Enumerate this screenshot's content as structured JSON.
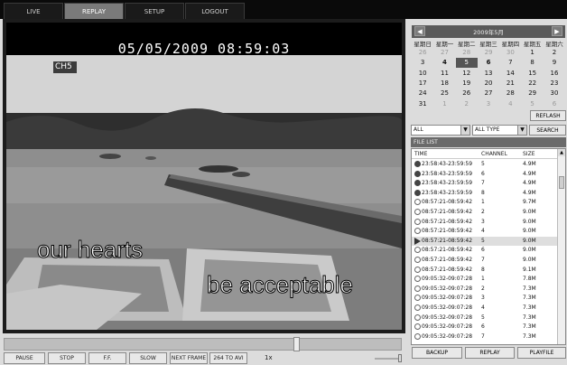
{
  "tabs": [
    "LIVE",
    "REPLAY",
    "SETUP",
    "LOGOUT"
  ],
  "video": {
    "timestamp": "05/05/2009 08:59:03",
    "channel_label": "CH5",
    "caption_line1": "our hearts",
    "caption_line2": "be acceptable"
  },
  "controls": {
    "buttons": [
      "PAUSE",
      "STOP",
      "F.F.",
      "SLOW",
      "NEXT FRAME",
      "264 TO AVI"
    ],
    "speed": "1x",
    "progress": 0.74
  },
  "calendar": {
    "title": "2009年5月",
    "weekdays": [
      "星期日",
      "星期一",
      "星期二",
      "星期三",
      "星期四",
      "星期五",
      "星期六"
    ],
    "weeks": [
      [
        "26",
        "27",
        "28",
        "29",
        "30",
        "1",
        "2"
      ],
      [
        "3",
        "4",
        "5",
        "6",
        "7",
        "8",
        "9"
      ],
      [
        "10",
        "11",
        "12",
        "13",
        "14",
        "15",
        "16"
      ],
      [
        "17",
        "18",
        "19",
        "20",
        "21",
        "22",
        "23"
      ],
      [
        "24",
        "25",
        "26",
        "27",
        "28",
        "29",
        "30"
      ],
      [
        "31",
        "1",
        "2",
        "3",
        "4",
        "5",
        "6"
      ]
    ],
    "refresh_label": "REFLASH"
  },
  "filters": {
    "channel": "ALL",
    "type": "ALL TYPE",
    "search_label": "SEARCH"
  },
  "file_list": {
    "title": "FILE LIST",
    "headers": [
      "TIME",
      "CHANNEL",
      "SIZE"
    ],
    "rows": [
      {
        "time": "23:58:43-23:59:59",
        "channel": "5",
        "size": "4.9M",
        "type": "alarm"
      },
      {
        "time": "23:58:43-23:59:59",
        "channel": "6",
        "size": "4.9M",
        "type": "alarm"
      },
      {
        "time": "23:58:43-23:59:59",
        "channel": "7",
        "size": "4.9M",
        "type": "alarm"
      },
      {
        "time": "23:58:43-23:59:59",
        "channel": "8",
        "size": "4.9M",
        "type": "alarm"
      },
      {
        "time": "08:57:21-08:59:42",
        "channel": "1",
        "size": "9.7M",
        "type": "normal"
      },
      {
        "time": "08:57:21-08:59:42",
        "channel": "2",
        "size": "9.0M",
        "type": "normal"
      },
      {
        "time": "08:57:21-08:59:42",
        "channel": "3",
        "size": "9.0M",
        "type": "normal"
      },
      {
        "time": "08:57:21-08:59:42",
        "channel": "4",
        "size": "9.0M",
        "type": "normal"
      },
      {
        "time": "08:57:21-08:59:42",
        "channel": "5",
        "size": "9.0M",
        "type": "playing"
      },
      {
        "time": "08:57:21-08:59:42",
        "channel": "6",
        "size": "9.0M",
        "type": "normal"
      },
      {
        "time": "08:57:21-08:59:42",
        "channel": "7",
        "size": "9.0M",
        "type": "normal"
      },
      {
        "time": "08:57:21-08:59:42",
        "channel": "8",
        "size": "9.1M",
        "type": "normal"
      },
      {
        "time": "09:05:32-09:07:28",
        "channel": "1",
        "size": "7.8M",
        "type": "normal"
      },
      {
        "time": "09:05:32-09:07:28",
        "channel": "2",
        "size": "7.3M",
        "type": "normal"
      },
      {
        "time": "09:05:32-09:07:28",
        "channel": "3",
        "size": "7.3M",
        "type": "normal"
      },
      {
        "time": "09:05:32-09:07:28",
        "channel": "4",
        "size": "7.3M",
        "type": "normal"
      },
      {
        "time": "09:05:32-09:07:28",
        "channel": "5",
        "size": "7.3M",
        "type": "normal"
      },
      {
        "time": "09:05:32-09:07:28",
        "channel": "6",
        "size": "7.3M",
        "type": "normal"
      },
      {
        "time": "09:05:32-09:07:28",
        "channel": "7",
        "size": "7.3M",
        "type": "normal"
      }
    ]
  },
  "bottom_buttons": [
    "BACKUP",
    "REPLAY",
    "PLAYFILE"
  ]
}
